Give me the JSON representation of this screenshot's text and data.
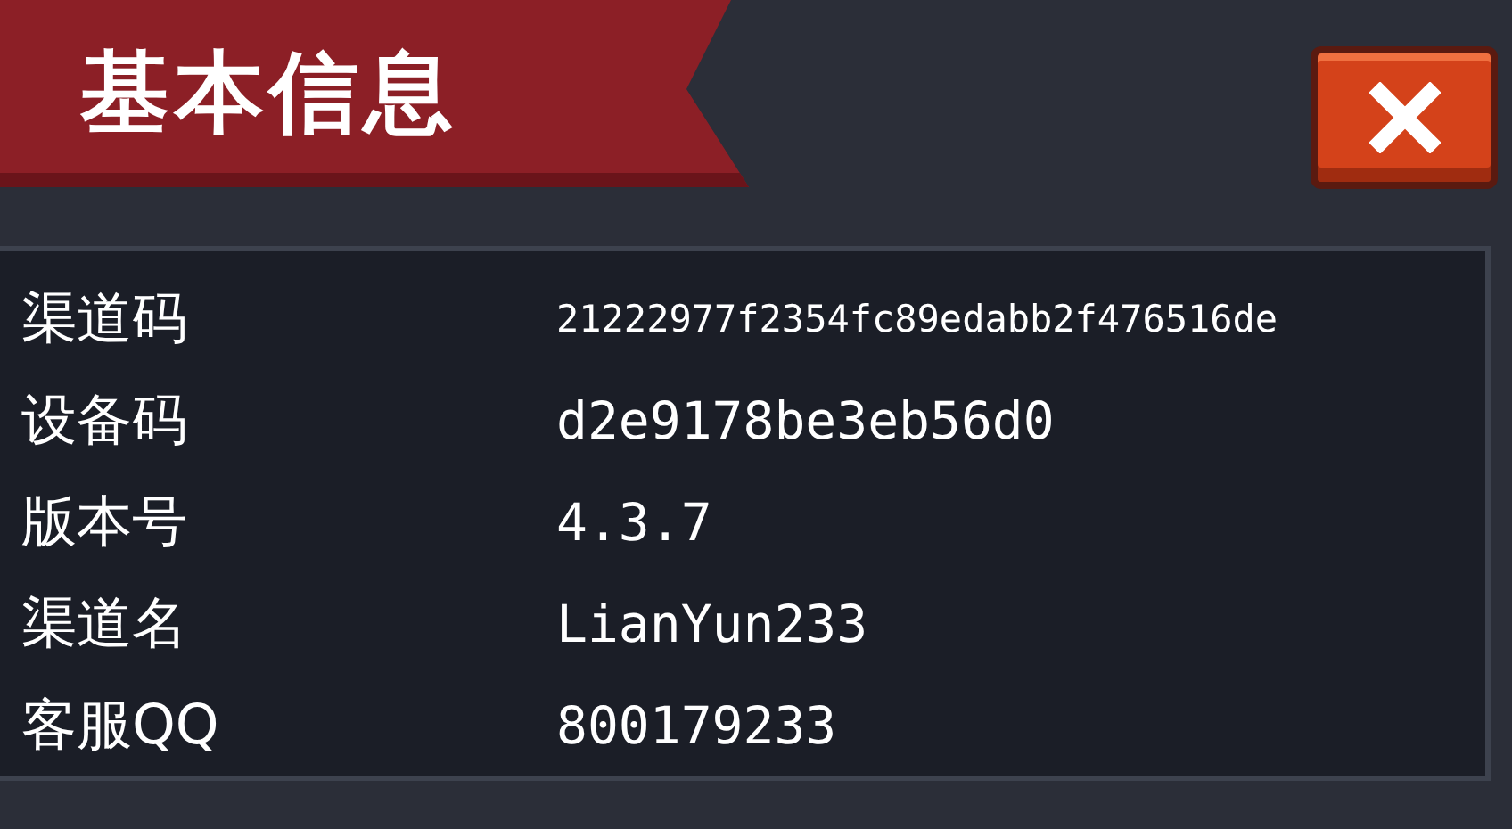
{
  "title": "基本信息",
  "rows": [
    {
      "label": "渠道码",
      "value": "21222977f2354fc89edabb2f476516de"
    },
    {
      "label": "设备码",
      "value": "d2e9178be3eb56d0"
    },
    {
      "label": "版本号",
      "value": "4.3.7"
    },
    {
      "label": "渠道名",
      "value": "LianYun233"
    },
    {
      "label": "客服QQ",
      "value": "800179233"
    }
  ]
}
